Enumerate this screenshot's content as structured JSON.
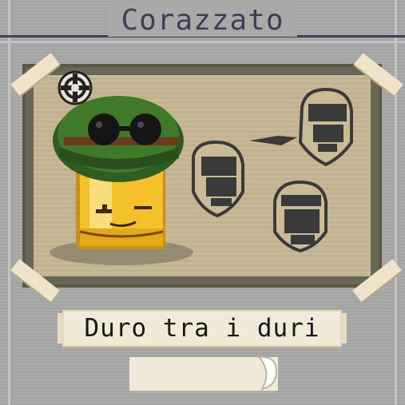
{
  "screen": {
    "title": "Corazzato",
    "card_label": "Duro tra i duri",
    "small_tag_text": ""
  },
  "icons": {
    "badge": "gear-badge-icon",
    "enemies": [
      "skull-enemy-icon",
      "skull-enemy-icon",
      "skull-enemy-icon"
    ],
    "arrow": "arrow-icon"
  },
  "colors": {
    "background": "#a9a9a9",
    "title": "#3e3d57",
    "card_frame": "#6a6655",
    "card_paper": "#c8b996",
    "tape": "#efe4c9",
    "hero_body": "#f4c12a",
    "helmet": "#3f7a2a",
    "ink": "#3a3a3a"
  }
}
